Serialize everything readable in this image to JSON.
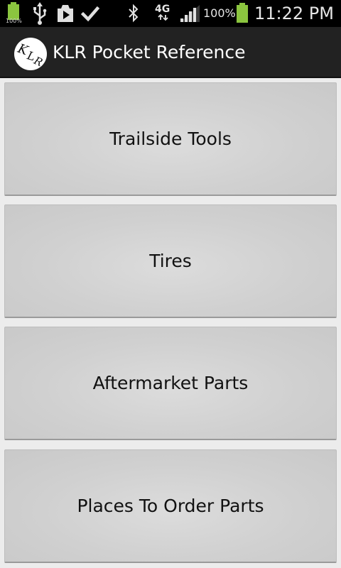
{
  "status_bar": {
    "battery_left_label": "100%",
    "battery_percent": "100%",
    "network_type": "4G",
    "time": "11:22 PM",
    "icons": [
      "battery-full-icon",
      "usb-icon",
      "play-store-icon",
      "check-icon",
      "bluetooth-icon",
      "data-arrows-icon",
      "signal-icon",
      "battery-charging-icon"
    ],
    "battery_color": "#8bc53f"
  },
  "action_bar": {
    "logo_text": "KLR",
    "title": "KLR Pocket Reference"
  },
  "menu": {
    "items": [
      {
        "label": "Trailside Tools"
      },
      {
        "label": "Tires"
      },
      {
        "label": "Aftermarket Parts"
      },
      {
        "label": "Places To Order Parts"
      }
    ]
  }
}
